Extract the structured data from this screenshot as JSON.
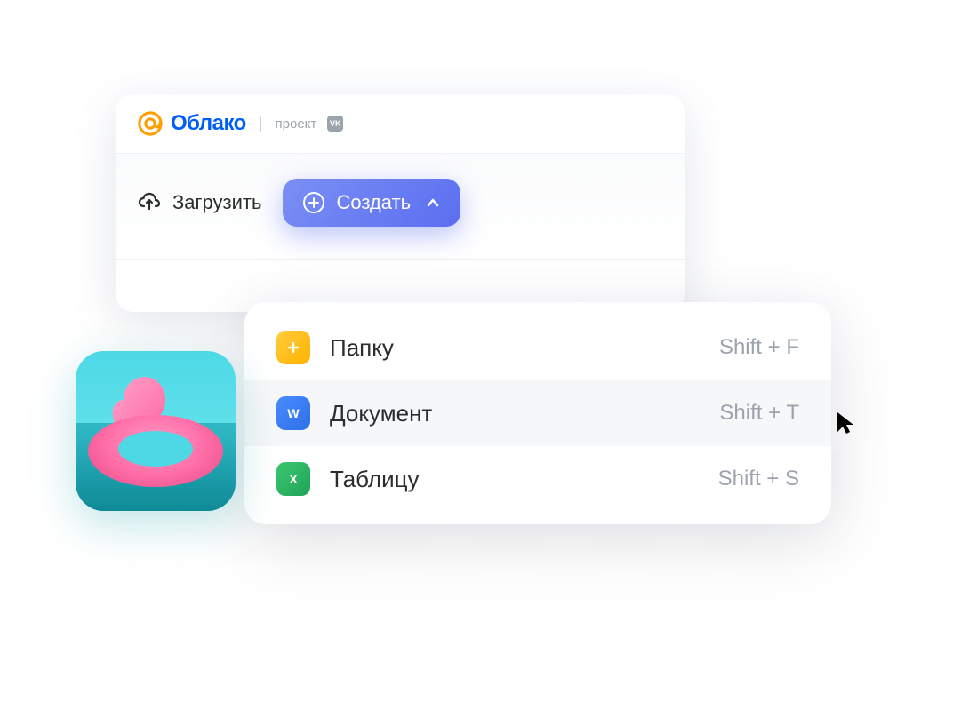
{
  "header": {
    "logo_text": "Облако",
    "project_label": "проект",
    "vk_label": "VK"
  },
  "toolbar": {
    "upload_label": "Загрузить",
    "create_label": "Создать"
  },
  "menu": {
    "items": [
      {
        "label": "Папку",
        "shortcut": "Shift + F",
        "icon_glyph": "+",
        "icon_class": "icon-folder"
      },
      {
        "label": "Документ",
        "shortcut": "Shift + T",
        "icon_glyph": "W",
        "icon_class": "icon-doc"
      },
      {
        "label": "Таблицу",
        "shortcut": "Shift + S",
        "icon_glyph": "X",
        "icon_class": "icon-sheet"
      }
    ]
  },
  "colors": {
    "accent": "#005ff9",
    "create_btn": "#5b6ef0",
    "folder_icon": "#ffb300",
    "doc_icon": "#2d6fe8",
    "sheet_icon": "#1fa356"
  }
}
